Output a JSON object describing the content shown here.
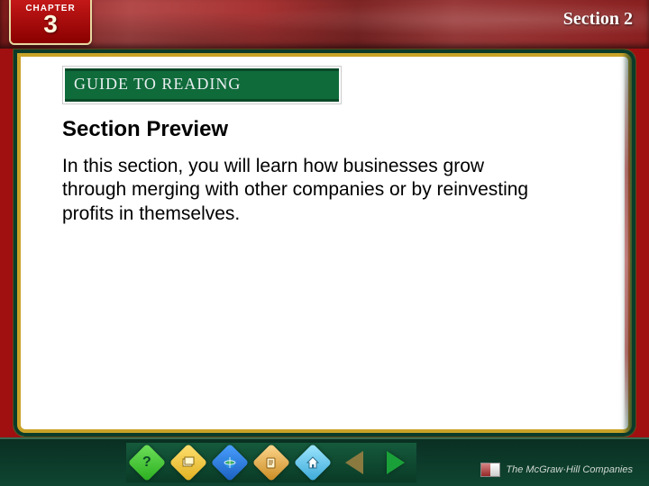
{
  "chapter": {
    "label": "CHAPTER",
    "number": "3"
  },
  "section_label": "Section 2",
  "guide_bar": "GUIDE TO READING",
  "title": "Section Preview",
  "body": "In this section, you will learn how businesses grow through merging with other companies or by reinvesting profits in themselves.",
  "footer": {
    "publisher": "The McGraw·Hill Companies"
  },
  "icons": {
    "help": "?",
    "slides": "slides-icon",
    "globe": "globe-icon",
    "scroll": "scroll-icon",
    "home": "home-icon",
    "prev": "prev-arrow",
    "next": "next-arrow"
  }
}
